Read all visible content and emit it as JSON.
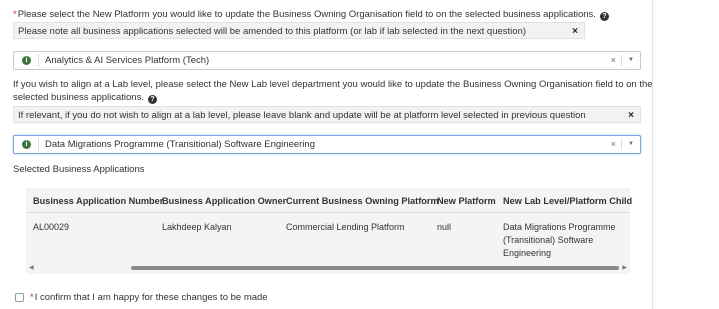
{
  "platform_question": {
    "required_marker": "*",
    "label": "Please select the New Platform you would like to update the Business Owning Organisation field to on the selected business applications.",
    "help_icon": "question-circle-icon",
    "note": "Please note all business applications selected will be amended to this platform (or lab if lab selected in the next question)",
    "note_close": "×",
    "selected_value": "Analytics & AI Services Platform (Tech)",
    "selected_icon": "info-circle-icon",
    "clear": "×"
  },
  "lab_question": {
    "label_line1": "If you wish to align at a Lab level, please select the New Lab level department you would like to update the Business Owning Organisation field to on the",
    "label_line2": "selected business applications.",
    "help_icon": "question-circle-icon",
    "note": "If relevant, if you do not wish to align at a lab level, please leave blank and update will be at platform level selected in previous question",
    "note_close": "×",
    "selected_value": "Data Migrations Programme (Transitional) Software Engineering",
    "selected_icon": "info-circle-icon",
    "clear": "×"
  },
  "selected_apps": {
    "title": "Selected Business Applications",
    "columns": [
      "Business Application Number",
      "Business Application Owner",
      "Current Business Owning Platform",
      "New Platform",
      "New Lab Level/Platform Child"
    ],
    "rows": [
      {
        "number": "AL00029",
        "owner": "Lakhdeep Kalyan",
        "current_platform": "Commercial Lending Platform",
        "new_platform": "null",
        "new_lab": [
          "Data Migrations Programme",
          "(Transitional) Software",
          "Engineering"
        ]
      }
    ]
  },
  "confirm": {
    "required_marker": "*",
    "label": "I confirm that I am happy for these changes to be made"
  }
}
